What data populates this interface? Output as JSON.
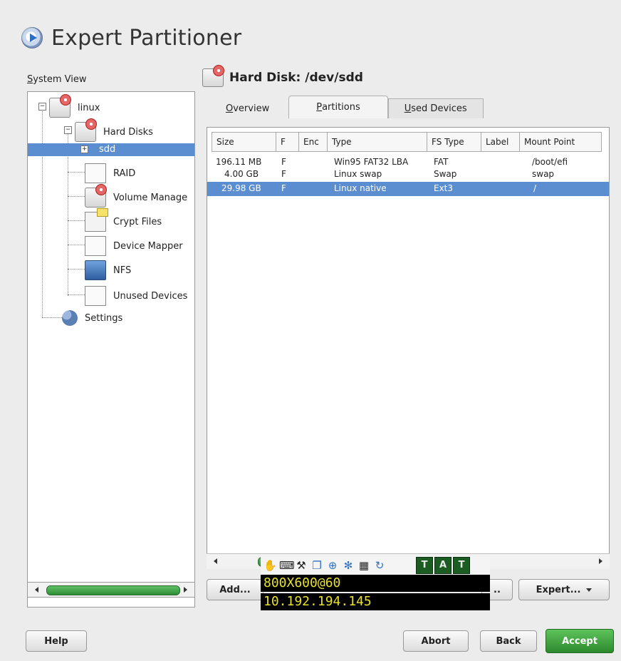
{
  "window": {
    "title": "Expert Partitioner",
    "title_icon": "arrow-bubble-icon"
  },
  "system_view": {
    "label_mnemonic": "S",
    "label_rest": "ystem View",
    "tree": [
      {
        "label": "linux",
        "icon": "hard-disk-icon"
      },
      {
        "label": "Hard Disks",
        "icon": "hard-disk-icon"
      },
      {
        "label": "sdd",
        "icon": "none",
        "selected": true
      },
      {
        "label": "RAID",
        "icon": "raid-icon"
      },
      {
        "label": "Volume Manage",
        "icon": "volume-manager-icon"
      },
      {
        "label": "Crypt Files",
        "icon": "crypt-files-icon"
      },
      {
        "label": "Device Mapper",
        "icon": "device-mapper-icon"
      },
      {
        "label": "NFS",
        "icon": "nfs-icon"
      },
      {
        "label": "Unused Devices",
        "icon": "unused-devices-icon"
      },
      {
        "label": "Settings",
        "icon": "settings-icon"
      }
    ]
  },
  "disk": {
    "title": "Hard Disk: /dev/sdd",
    "icon": "hard-disk-icon"
  },
  "tabs": [
    {
      "mnemonic": "O",
      "rest": "verview"
    },
    {
      "mnemonic": "P",
      "rest": "artitions",
      "active": true
    },
    {
      "mnemonic": "U",
      "rest": "sed Devices"
    }
  ],
  "table": {
    "columns": [
      "Size",
      "F",
      "Enc",
      "Type",
      "FS Type",
      "Label",
      "Mount Point"
    ],
    "rows": [
      {
        "size": "196.11 MB",
        "f": "F",
        "enc": "",
        "type": "Win95 FAT32 LBA",
        "fs_type": "FAT",
        "label": "",
        "mount": "/boot/efi"
      },
      {
        "size": "4.00 GB",
        "f": "F",
        "enc": "",
        "type": "Linux swap",
        "fs_type": "Swap",
        "label": "",
        "mount": "swap"
      },
      {
        "size": "29.98 GB",
        "f": "F",
        "enc": "",
        "type": "Linux native",
        "fs_type": "Ext3",
        "label": "",
        "mount": "/",
        "selected": true
      }
    ]
  },
  "buttons": {
    "add": "Add...",
    "edit_partial": "..",
    "expert": "Expert...",
    "help": "Help",
    "abort": "Abort",
    "back": "Back",
    "accept": "Accept"
  },
  "overlay": {
    "resolution": "800X600@60",
    "ip": "10.192.194.145",
    "tags": [
      "T",
      "A",
      "T"
    ]
  },
  "colors": {
    "selection": "#5b8ed1",
    "accept_green": "#3aa63a",
    "overlay_text": "#e7e12a"
  }
}
